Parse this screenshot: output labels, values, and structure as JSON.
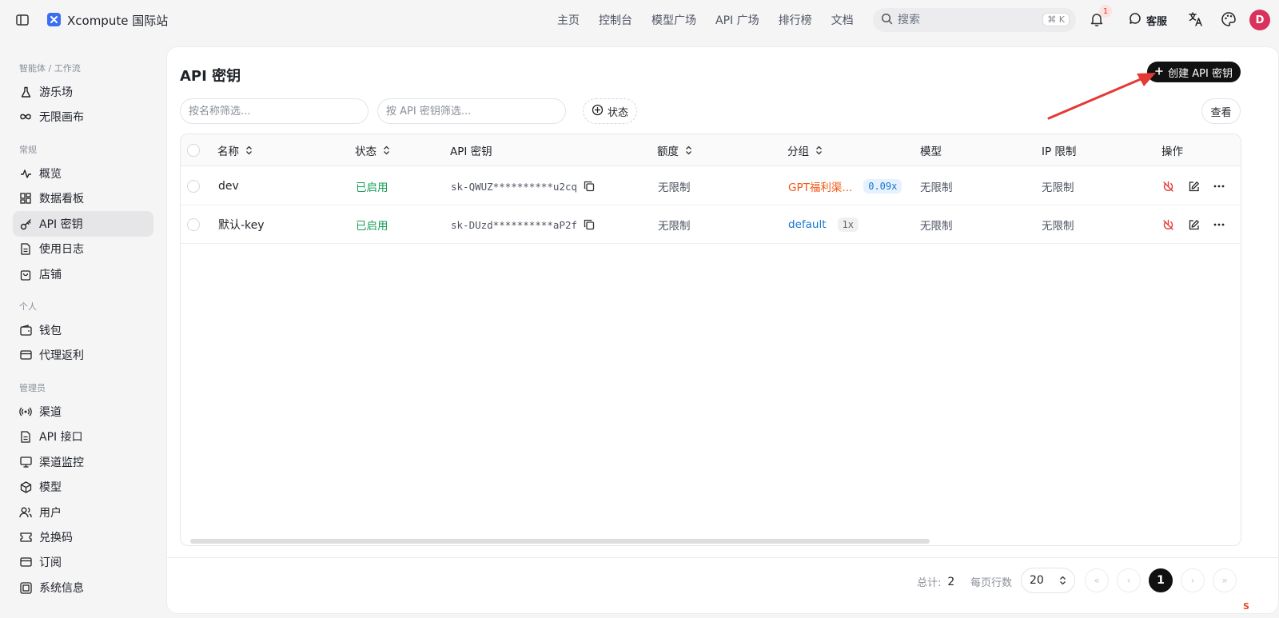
{
  "app": {
    "title": "Xcompute 国际站"
  },
  "topnav": [
    "主页",
    "控制台",
    "模型广场",
    "API 广场",
    "排行榜",
    "文档"
  ],
  "search": {
    "placeholder": "搜索",
    "shortcut": "⌘ K"
  },
  "notifications": {
    "count": "1"
  },
  "support_label": "客服",
  "avatar_initial": "D",
  "sidebar": {
    "sections": [
      {
        "title": "智能体 / 工作流",
        "items": [
          {
            "label": "游乐场",
            "icon": "flask-icon"
          },
          {
            "label": "无限画布",
            "icon": "infinity-icon"
          }
        ]
      },
      {
        "title": "常规",
        "items": [
          {
            "label": "概览",
            "icon": "activity-icon"
          },
          {
            "label": "数据看板",
            "icon": "dashboard-icon"
          },
          {
            "label": "API 密钥",
            "icon": "key-icon",
            "active": true
          },
          {
            "label": "使用日志",
            "icon": "document-icon"
          },
          {
            "label": "店铺",
            "icon": "bag-icon"
          }
        ]
      },
      {
        "title": "个人",
        "items": [
          {
            "label": "钱包",
            "icon": "wallet-icon"
          },
          {
            "label": "代理返利",
            "icon": "card-icon"
          }
        ]
      },
      {
        "title": "管理员",
        "items": [
          {
            "label": "渠道",
            "icon": "radio-icon"
          },
          {
            "label": "API 接口",
            "icon": "document-icon"
          },
          {
            "label": "渠道监控",
            "icon": "monitor-icon"
          },
          {
            "label": "模型",
            "icon": "cube-icon"
          },
          {
            "label": "用户",
            "icon": "users-icon"
          },
          {
            "label": "兑换码",
            "icon": "ticket-icon"
          },
          {
            "label": "订阅",
            "icon": "card-icon"
          },
          {
            "label": "系统信息",
            "icon": "server-icon"
          }
        ]
      }
    ]
  },
  "main": {
    "title": "API 密钥",
    "create_label": "创建 API 密钥",
    "filter_name_placeholder": "按名称筛选...",
    "filter_key_placeholder": "按 API 密钥筛选...",
    "status_filter_label": "状态",
    "view_label": "查看",
    "columns": {
      "name": "名称",
      "status": "状态",
      "key": "API 密钥",
      "quota": "额度",
      "group": "分组",
      "model": "模型",
      "ip": "IP 限制",
      "actions": "操作"
    },
    "rows": [
      {
        "name": "dev",
        "status": "已启用",
        "key": "sk-QWUZ**********u2cq",
        "quota": "无限制",
        "group": "GPT福利渠...",
        "ratio": "0.09x",
        "model": "无限制",
        "ip": "无限制"
      },
      {
        "name": "默认-key",
        "status": "已启用",
        "key": "sk-DUzd**********aP2f",
        "quota": "无限制",
        "group": "default",
        "ratio": "1x",
        "model": "无限制",
        "ip": "无限制"
      }
    ],
    "footer": {
      "total_label": "总计:",
      "total": "2",
      "per_page_label": "每页行数",
      "page_size": "20",
      "current_page": "1"
    }
  },
  "colors": {
    "accent": "#111111",
    "enabled": "#18a058",
    "group_orange": "#f05a16",
    "group_blue": "#1677d2",
    "avatar": "#d9325c",
    "annotation_arrow": "#e53935"
  }
}
